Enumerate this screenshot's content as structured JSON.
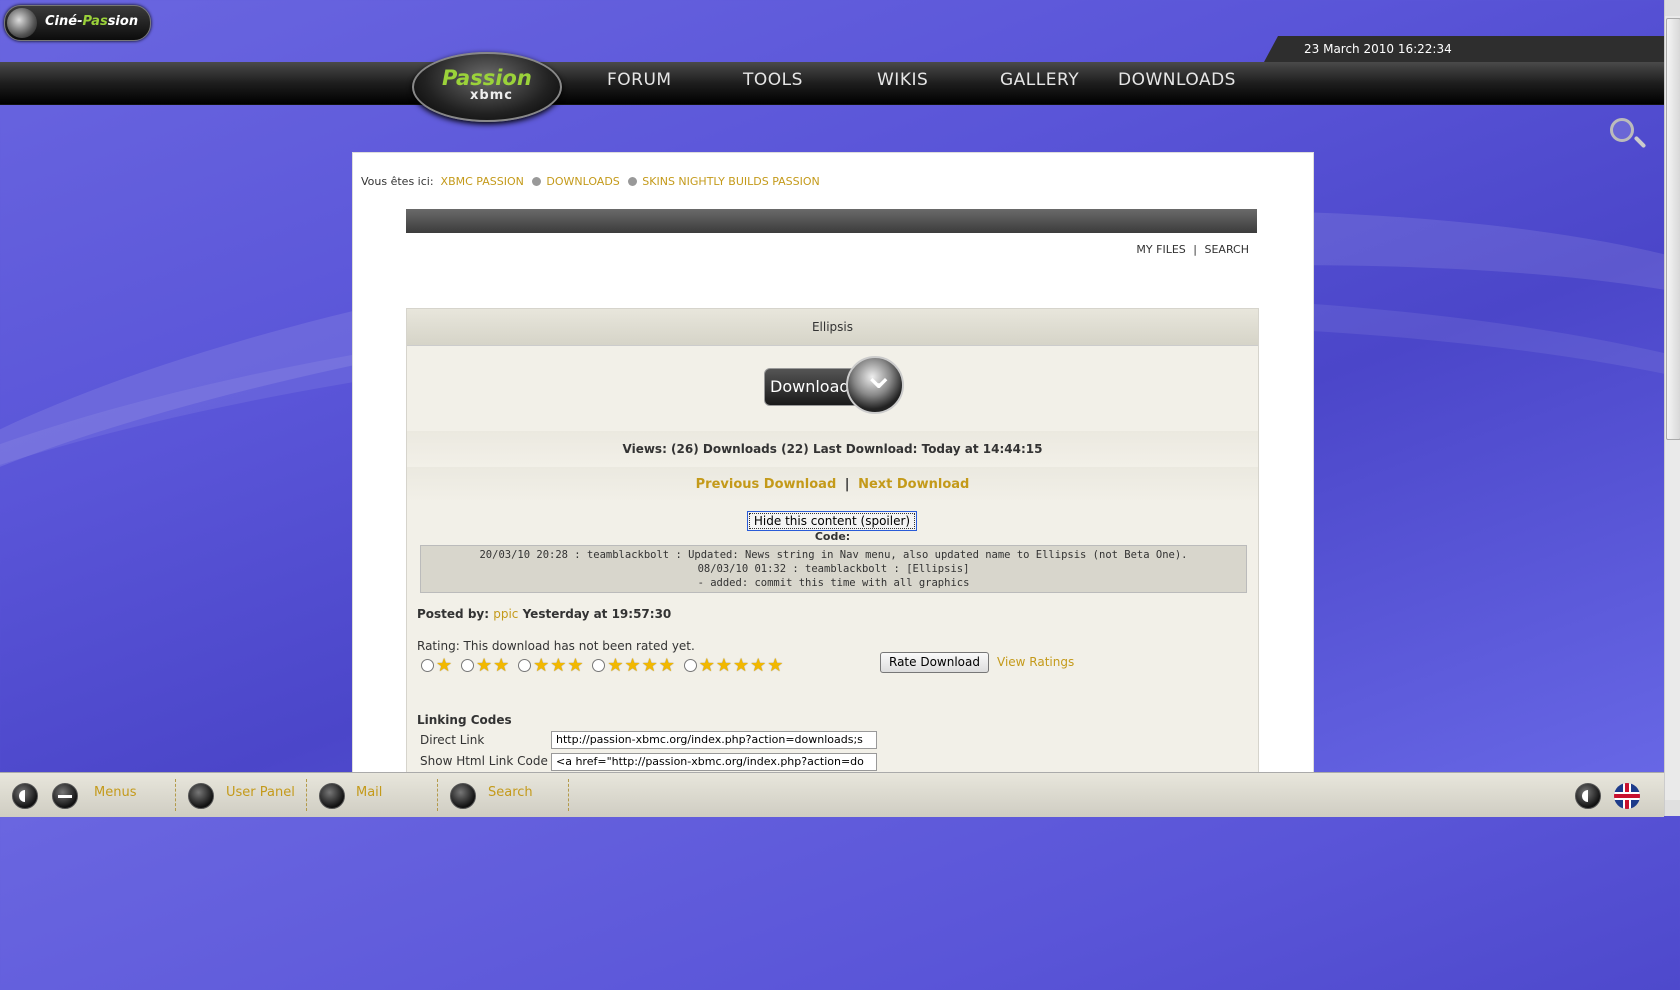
{
  "site": {
    "cine_logo": {
      "part1": "Ciné-",
      "part2": "Pas",
      "part3": "sion"
    },
    "date": "23 March 2010 16:22:34",
    "nav_logo": {
      "top": "Passion",
      "bottom": "xbmc"
    },
    "nav": [
      "FORUM",
      "TOOLS",
      "WIKIS",
      "GALLERY",
      "DOWNLOADS"
    ]
  },
  "breadcrumb": {
    "prefix": "Vous êtes ici:",
    "items": [
      "XBMC PASSION",
      "DOWNLOADS",
      "SKINS NIGHTLY BUILDS PASSION"
    ]
  },
  "toolbar": {
    "my_files": "MY FILES",
    "separator": "|",
    "search": "SEARCH"
  },
  "download": {
    "title": "Ellipsis",
    "button_label": "Download",
    "stats": "Views: (26)  Downloads (22)  Last Download: Today at 14:44:15",
    "prev_label": "Previous Download",
    "next_label": "Next Download",
    "nav_sep": "|",
    "spoiler_button": "Hide this content (spoiler)",
    "code_label": "Code:",
    "code_lines": [
      "20/03/10 20:28 : teamblackbolt : Updated: News string in Nav menu, also updated name to Ellipsis (not Beta One).",
      "08/03/10 01:32 : teamblackbolt : [Ellipsis]",
      "- added: commit this time with all graphics"
    ],
    "posted_by_label": "Posted by:",
    "posted_by_user": "ppic",
    "posted_time": "Yesterday at 19:57:30",
    "rating_text": "Rating: This download has not been rated yet.",
    "rating_options": [
      "★",
      "★★",
      "★★★",
      "★★★★",
      "★★★★★"
    ],
    "rate_button": "Rate Download",
    "view_ratings": "View Ratings",
    "linking_title": "Linking Codes",
    "direct_link_label": "Direct Link",
    "direct_link_value": "http://passion-xbmc.org/index.php?action=downloads;s",
    "html_link_label": "Show Html Link Code",
    "html_link_value": "<a href=\"http://passion-xbmc.org/index.php?action=do"
  },
  "bottombar": {
    "menus": "Menus",
    "user_panel": "User Panel",
    "mail": "Mail",
    "search": "Search"
  }
}
